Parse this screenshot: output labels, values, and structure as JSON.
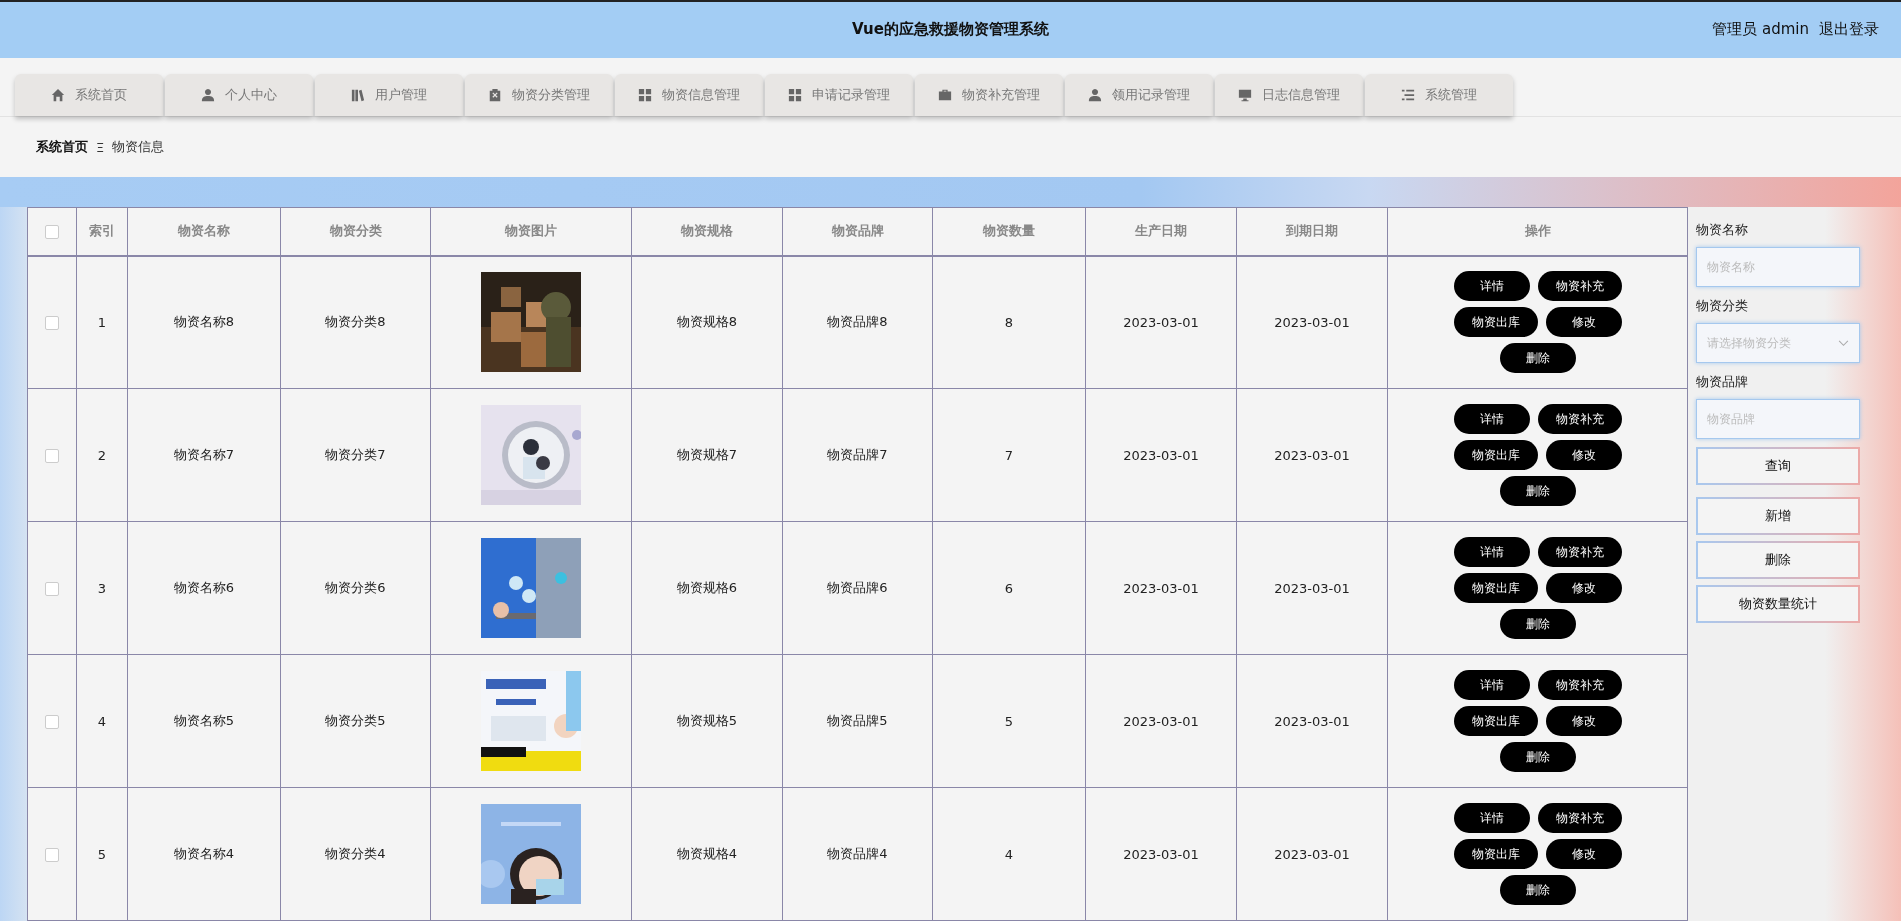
{
  "header": {
    "title": "Vue的应急救援物资管理系统",
    "user": "管理员 admin",
    "logout": "退出登录"
  },
  "nav": [
    {
      "label": "系统首页"
    },
    {
      "label": "个人中心"
    },
    {
      "label": "用户管理"
    },
    {
      "label": "物资分类管理"
    },
    {
      "label": "物资信息管理"
    },
    {
      "label": "申请记录管理"
    },
    {
      "label": "物资补充管理"
    },
    {
      "label": "领用记录管理"
    },
    {
      "label": "日志信息管理"
    },
    {
      "label": "系统管理"
    }
  ],
  "breadcrumb": {
    "home": "系统首页",
    "separator": "Ξ",
    "current": "物资信息"
  },
  "table": {
    "all_checked": false,
    "columns": [
      "索引",
      "物资名称",
      "物资分类",
      "物资图片",
      "物资规格",
      "物资品牌",
      "物资数量",
      "生产日期",
      "到期日期",
      "操作"
    ],
    "rows": [
      {
        "checked": false,
        "index": "1",
        "name": "物资名称8",
        "category": "物资分类8",
        "spec": "物资规格8",
        "brand": "物资品牌8",
        "quantity": "8",
        "produced": "2023-03-01",
        "expires": "2023-03-01",
        "actions": [
          "详情",
          "物资补充",
          "物资出库",
          "修改",
          "删除"
        ]
      },
      {
        "checked": false,
        "index": "2",
        "name": "物资名称7",
        "category": "物资分类7",
        "spec": "物资规格7",
        "brand": "物资品牌7",
        "quantity": "7",
        "produced": "2023-03-01",
        "expires": "2023-03-01",
        "actions": [
          "详情",
          "物资补充",
          "物资出库",
          "修改",
          "删除"
        ]
      },
      {
        "checked": false,
        "index": "3",
        "name": "物资名称6",
        "category": "物资分类6",
        "spec": "物资规格6",
        "brand": "物资品牌6",
        "quantity": "6",
        "produced": "2023-03-01",
        "expires": "2023-03-01",
        "actions": [
          "详情",
          "物资补充",
          "物资出库",
          "修改",
          "删除"
        ]
      },
      {
        "checked": false,
        "index": "4",
        "name": "物资名称5",
        "category": "物资分类5",
        "spec": "物资规格5",
        "brand": "物资品牌5",
        "quantity": "5",
        "produced": "2023-03-01",
        "expires": "2023-03-01",
        "actions": [
          "详情",
          "物资补充",
          "物资出库",
          "修改",
          "删除"
        ]
      },
      {
        "checked": false,
        "index": "5",
        "name": "物资名称4",
        "category": "物资分类4",
        "spec": "物资规格4",
        "brand": "物资品牌4",
        "quantity": "4",
        "produced": "2023-03-01",
        "expires": "2023-03-01",
        "actions": [
          "详情",
          "物资补充",
          "物资出库",
          "修改",
          "删除"
        ]
      }
    ]
  },
  "search": {
    "fields": [
      {
        "label": "物资名称",
        "kind": "input",
        "placeholder": "物资名称"
      },
      {
        "label": "物资分类",
        "kind": "select",
        "placeholder": "请选择物资分类"
      },
      {
        "label": "物资品牌",
        "kind": "input",
        "placeholder": "物资品牌"
      }
    ],
    "query_button": "查询",
    "buttons": [
      "新增",
      "删除",
      "物资数量统计"
    ]
  }
}
